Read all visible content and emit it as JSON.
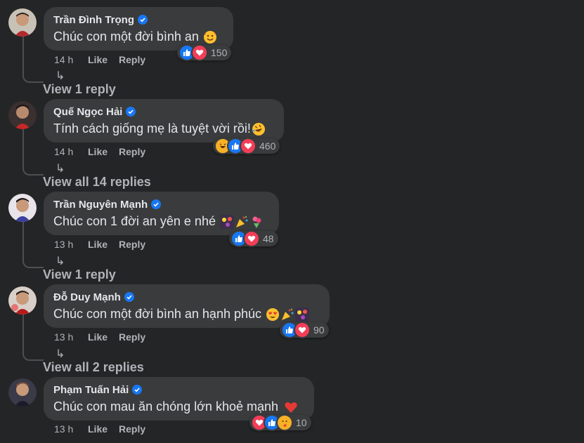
{
  "comments": [
    {
      "name": "Trần Đình Trọng",
      "text": "Chúc con một đời bình an",
      "time": "14 h",
      "like": "Like",
      "reply": "Reply",
      "reaction_count": "150",
      "reactions": [
        "like-icon",
        "love-icon"
      ],
      "emojis": [
        "smiling-face-with-hearts-emoji"
      ],
      "view_replies": "View 1 reply"
    },
    {
      "name": "Quế Ngọc Hải",
      "text": "Tính cách giống mẹ là tuyệt vời rồi!",
      "time": "14 h",
      "like": "Like",
      "reply": "Reply",
      "reaction_count": "460",
      "reactions": [
        "haha-icon",
        "like-icon",
        "love-icon"
      ],
      "emojis": [
        "rolling-laughing-emoji"
      ],
      "view_replies": "View all 14 replies"
    },
    {
      "name": "Trần Nguyên Mạnh",
      "text": "Chúc con 1 đời an yên e nhé",
      "time": "13 h",
      "like": "Like",
      "reply": "Reply",
      "reaction_count": "48",
      "reactions": [
        "like-icon",
        "love-icon"
      ],
      "emojis": [
        "fireworks-emoji",
        "party-popper-emoji",
        "bouquet-emoji"
      ],
      "view_replies": "View 1 reply"
    },
    {
      "name": "Đỗ Duy Mạnh",
      "text": "Chúc con một đời bình an hạnh phúc",
      "time": "13 h",
      "like": "Like",
      "reply": "Reply",
      "reaction_count": "90",
      "reactions": [
        "like-icon",
        "love-icon"
      ],
      "emojis": [
        "heart-eyes-emoji",
        "party-popper-emoji",
        "fireworks-emoji"
      ],
      "view_replies": "View all 2 replies"
    },
    {
      "name": "Phạm Tuấn Hải",
      "text": "Chúc con mau ăn chóng lớn khoẻ mạnh",
      "time": "13 h",
      "like": "Like",
      "reply": "Reply",
      "reaction_count": "10",
      "reactions": [
        "love-icon",
        "like-icon",
        "care-icon"
      ],
      "emojis": [
        "red-heart-emoji"
      ],
      "view_replies": ""
    }
  ],
  "colors": {
    "background": "#242526",
    "bubble": "#3a3b3c",
    "text": "#e4e6eb",
    "secondary": "#b0b3b8",
    "like_blue": "#1877f2",
    "love_red": "#f33e58",
    "haha_yellow": "#f7b125"
  }
}
